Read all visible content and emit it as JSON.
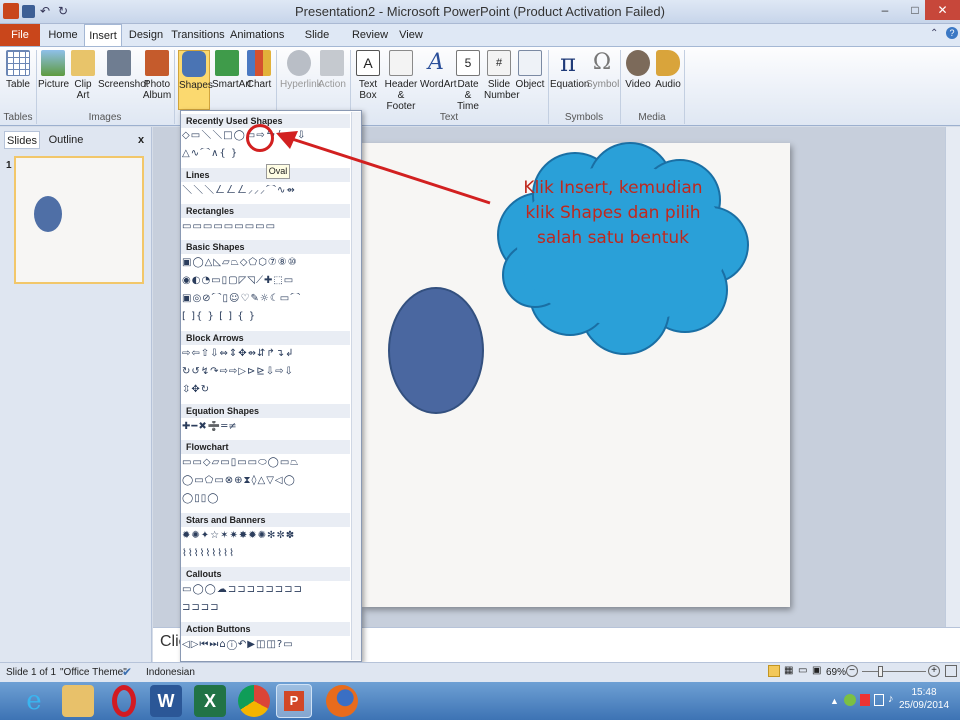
{
  "window": {
    "title": "Presentation2 - Microsoft PowerPoint (Product Activation Failed)",
    "controls": {
      "minimize": "–",
      "restore": "□",
      "close": "✕"
    }
  },
  "tabs": [
    "File",
    "Home",
    "Insert",
    "Design",
    "Transitions",
    "Animations",
    "Slide Show",
    "Review",
    "View"
  ],
  "ribbon": {
    "buttons": {
      "table": "Table",
      "picture": "Picture",
      "clip_art": "Clip Art",
      "screenshot": "Screenshot",
      "photo_album": "Photo Album",
      "shapes": "Shapes",
      "smartart": "SmartArt",
      "chart": "Chart",
      "hyperlink": "Hyperlink",
      "action": "Action",
      "text_box": "Text Box",
      "header_footer": "Header & Footer",
      "wordart": "WordArt",
      "date_time": "Date & Time",
      "slide_number": "Slide Number",
      "object": "Object",
      "equation": "Equation",
      "symbol": "Symbol",
      "video": "Video",
      "audio": "Audio"
    },
    "groups": {
      "tables": "Tables",
      "images": "Images",
      "text": "Text",
      "symbols": "Symbols",
      "media": "Media"
    }
  },
  "left_pane": {
    "tabs": [
      "Slides",
      "Outline"
    ],
    "close": "x",
    "slide_number": "1"
  },
  "gallery": {
    "sections": {
      "recent": "Recently Used Shapes",
      "lines": "Lines",
      "rectangles": "Rectangles",
      "basic": "Basic Shapes",
      "block_arrows": "Block Arrows",
      "equation": "Equation Shapes",
      "flowchart": "Flowchart",
      "stars": "Stars and Banners",
      "callouts": "Callouts",
      "action": "Action Buttons"
    },
    "tooltip": "Oval"
  },
  "callout": {
    "text": "Klik Insert, kemudian klik Shapes dan pilih salah satu bentuk"
  },
  "notes": {
    "placeholder": "Clic"
  },
  "status": {
    "slide": "Slide 1 of 1",
    "theme": "\"Office Theme\"",
    "language": "Indonesian",
    "zoom": "69%"
  },
  "taskbar": {
    "time": "15:48",
    "date": "25/09/2014"
  },
  "colors": {
    "file_tab": "#c9461b",
    "oval": "#4a67a0",
    "callout": "#2aa0d8",
    "annotation": "#d22020"
  }
}
